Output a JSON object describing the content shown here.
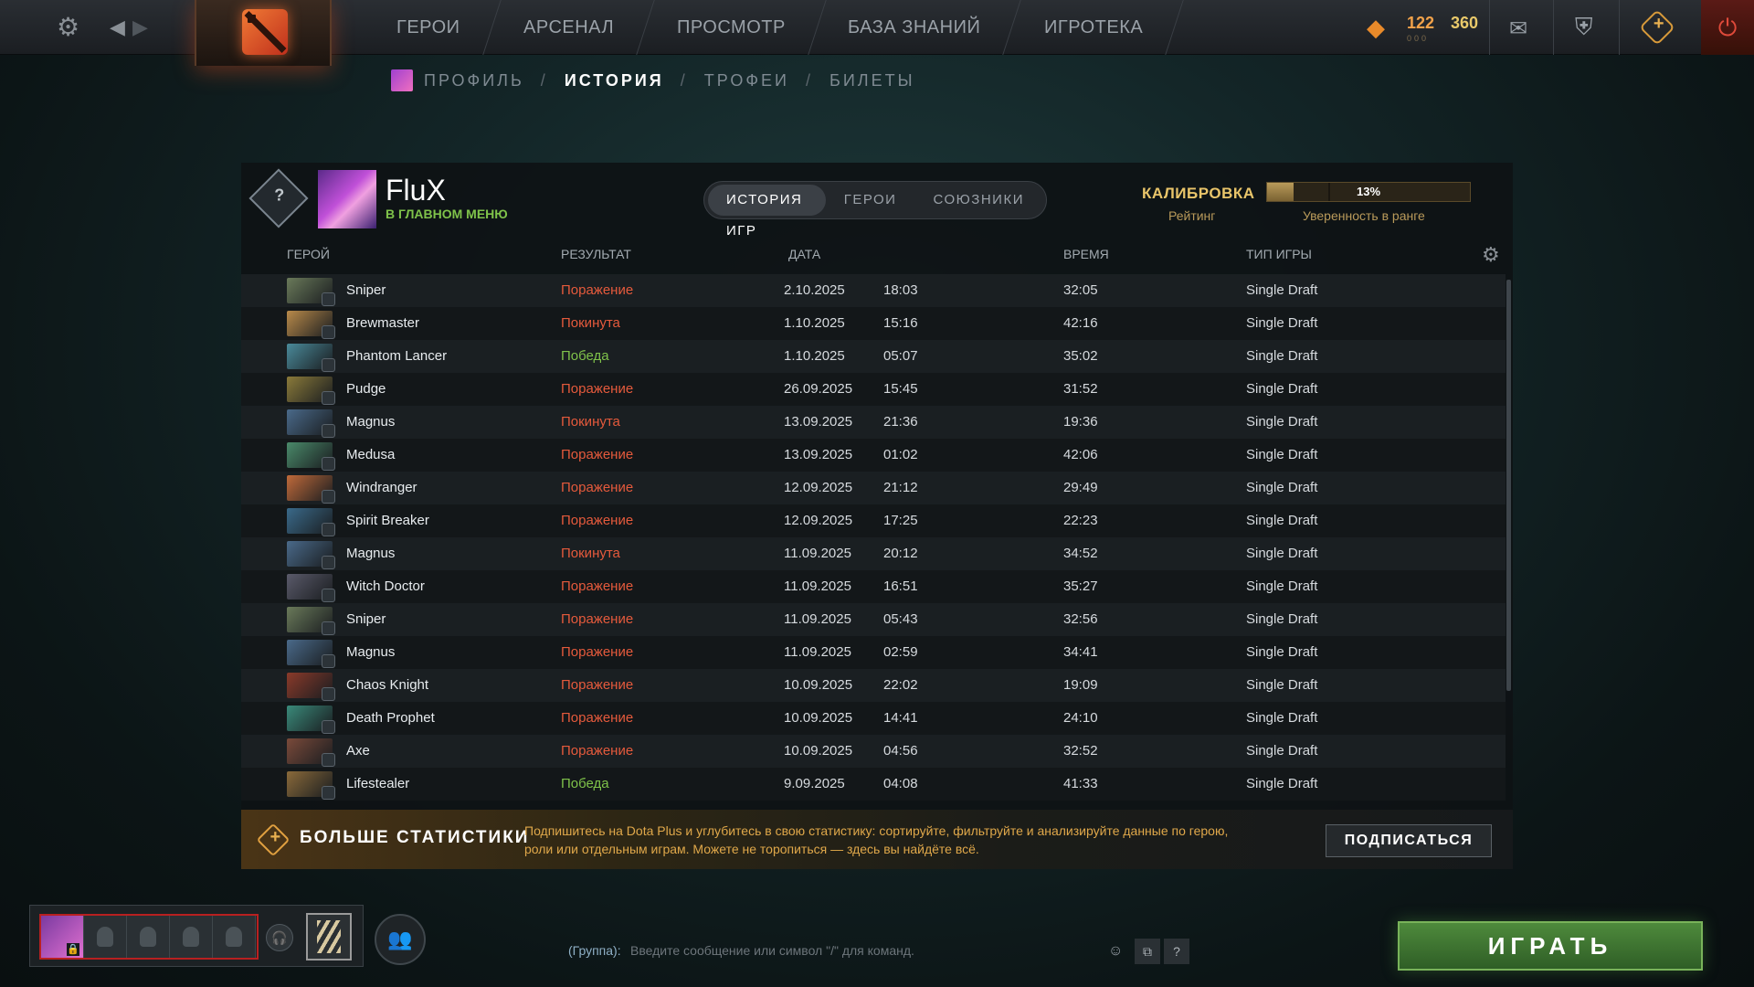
{
  "topbar": {
    "nav": [
      "ГЕРОИ",
      "АРСЕНАЛ",
      "ПРОСМОТР",
      "БАЗА ЗНАНИЙ",
      "ИГРОТЕКА"
    ],
    "shards": "122",
    "shards_sub": "000",
    "battle_level": "360"
  },
  "breadcrumbs": {
    "profile": "ПРОФИЛЬ",
    "history": "ИСТОРИЯ",
    "trophies": "ТРОФЕИ",
    "tickets": "БИЛЕТЫ",
    "sep": "/"
  },
  "player": {
    "name": "FluX",
    "status": "В ГЛАВНОМ МЕНЮ",
    "rank_badge": "?"
  },
  "tabs": [
    "ИСТОРИЯ ИГР",
    "ГЕРОИ",
    "СОЮЗНИКИ"
  ],
  "calibration": {
    "title": "КАЛИБРОВКА",
    "rating_label": "Рейтинг",
    "confidence_value": "13%",
    "confidence_fraction": 0.13,
    "confidence_label": "Уверенность в ранге"
  },
  "table": {
    "headers": {
      "hero": "ГЕРОЙ",
      "result": "РЕЗУЛЬТАТ",
      "date": "ДАТА",
      "duration": "ВРЕМЯ",
      "mode": "ТИП ИГРЫ"
    },
    "rows": [
      {
        "hero": "Sniper",
        "result": "Поражение",
        "kind": "loss",
        "date": "2.10.2025",
        "time": "18:03",
        "duration": "32:05",
        "mode": "Single Draft",
        "color": "#6a7a5a"
      },
      {
        "hero": "Brewmaster",
        "result": "Покинута",
        "kind": "aband",
        "date": "1.10.2025",
        "time": "15:16",
        "duration": "42:16",
        "mode": "Single Draft",
        "color": "#b98a4a"
      },
      {
        "hero": "Phantom Lancer",
        "result": "Победа",
        "kind": "win",
        "date": "1.10.2025",
        "time": "05:07",
        "duration": "35:02",
        "mode": "Single Draft",
        "color": "#4a8a9a"
      },
      {
        "hero": "Pudge",
        "result": "Поражение",
        "kind": "loss",
        "date": "26.09.2025",
        "time": "15:45",
        "duration": "31:52",
        "mode": "Single Draft",
        "color": "#8a7a3a"
      },
      {
        "hero": "Magnus",
        "result": "Покинута",
        "kind": "aband",
        "date": "13.09.2025",
        "time": "21:36",
        "duration": "19:36",
        "mode": "Single Draft",
        "color": "#4a6a8a"
      },
      {
        "hero": "Medusa",
        "result": "Поражение",
        "kind": "loss",
        "date": "13.09.2025",
        "time": "01:02",
        "duration": "42:06",
        "mode": "Single Draft",
        "color": "#4a8a6a"
      },
      {
        "hero": "Windranger",
        "result": "Поражение",
        "kind": "loss",
        "date": "12.09.2025",
        "time": "21:12",
        "duration": "29:49",
        "mode": "Single Draft",
        "color": "#c06a3a"
      },
      {
        "hero": "Spirit Breaker",
        "result": "Поражение",
        "kind": "loss",
        "date": "12.09.2025",
        "time": "17:25",
        "duration": "22:23",
        "mode": "Single Draft",
        "color": "#3a6a8a"
      },
      {
        "hero": "Magnus",
        "result": "Покинута",
        "kind": "aband",
        "date": "11.09.2025",
        "time": "20:12",
        "duration": "34:52",
        "mode": "Single Draft",
        "color": "#4a6a8a"
      },
      {
        "hero": "Witch Doctor",
        "result": "Поражение",
        "kind": "loss",
        "date": "11.09.2025",
        "time": "16:51",
        "duration": "35:27",
        "mode": "Single Draft",
        "color": "#5a5a6a"
      },
      {
        "hero": "Sniper",
        "result": "Поражение",
        "kind": "loss",
        "date": "11.09.2025",
        "time": "05:43",
        "duration": "32:56",
        "mode": "Single Draft",
        "color": "#6a7a5a"
      },
      {
        "hero": "Magnus",
        "result": "Поражение",
        "kind": "loss",
        "date": "11.09.2025",
        "time": "02:59",
        "duration": "34:41",
        "mode": "Single Draft",
        "color": "#4a6a8a"
      },
      {
        "hero": "Chaos Knight",
        "result": "Поражение",
        "kind": "loss",
        "date": "10.09.2025",
        "time": "22:02",
        "duration": "19:09",
        "mode": "Single Draft",
        "color": "#8a3a2a"
      },
      {
        "hero": "Death Prophet",
        "result": "Поражение",
        "kind": "loss",
        "date": "10.09.2025",
        "time": "14:41",
        "duration": "24:10",
        "mode": "Single Draft",
        "color": "#3a8a7a"
      },
      {
        "hero": "Axe",
        "result": "Поражение",
        "kind": "loss",
        "date": "10.09.2025",
        "time": "04:56",
        "duration": "32:52",
        "mode": "Single Draft",
        "color": "#7a4a3a"
      },
      {
        "hero": "Lifestealer",
        "result": "Победа",
        "kind": "win",
        "date": "9.09.2025",
        "time": "04:08",
        "duration": "41:33",
        "mode": "Single Draft",
        "color": "#8a6a3a"
      }
    ]
  },
  "banner": {
    "title": "БОЛЬШЕ СТАТИСТИКИ",
    "text": "Подпишитесь на Dota Plus и углубитесь в свою статистику: сортируйте, фильтруйте и анализируйте данные по герою, роли или отдельным играм. Можете не торопиться — здесь вы найдёте всё.",
    "button": "ПОДПИСАТЬСЯ"
  },
  "chat": {
    "label": "(Группа):",
    "placeholder": "Введите сообщение или символ \"/\" для команд.",
    "help": "?"
  },
  "play_button": "ИГРАТЬ",
  "colors": {
    "loss": "#e55a3c",
    "win": "#7fc24a",
    "accent_gold": "#e9c56a",
    "play_green": "#4e8a3c"
  }
}
